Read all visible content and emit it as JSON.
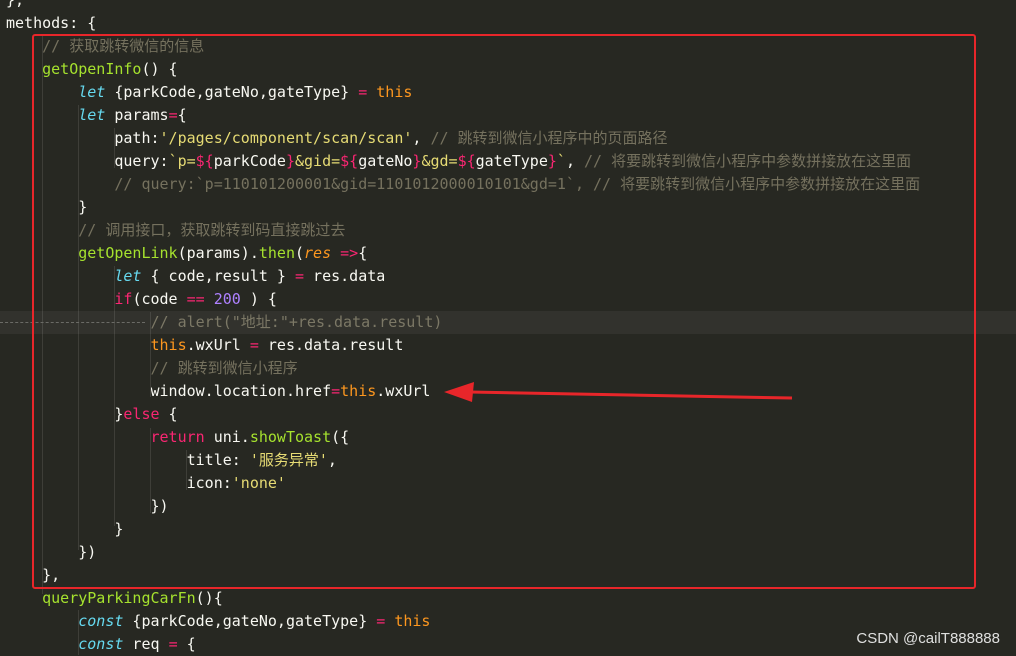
{
  "editor": {
    "lines": [
      {
        "t": [
          [
            "plain",
            "},"
          ]
        ]
      },
      {
        "t": [
          [
            "plain",
            "methods: {"
          ]
        ]
      },
      {
        "t": [
          [
            "plain",
            "    "
          ],
          [
            "c",
            "// 获取跳转微信的信息"
          ]
        ]
      },
      {
        "t": [
          [
            "plain",
            "    "
          ],
          [
            "fn",
            "getOpenInfo"
          ],
          [
            "plain",
            "() {"
          ]
        ]
      },
      {
        "t": [
          [
            "plain",
            "        "
          ],
          [
            "kw",
            "let"
          ],
          [
            "plain",
            " {parkCode,gateNo,gateType} "
          ],
          [
            "op",
            "="
          ],
          [
            "plain",
            " "
          ],
          [
            "this",
            "this"
          ]
        ]
      },
      {
        "t": [
          [
            "plain",
            "        "
          ],
          [
            "kw",
            "let"
          ],
          [
            "plain",
            " params"
          ],
          [
            "op",
            "="
          ],
          [
            "plain",
            "{"
          ]
        ]
      },
      {
        "t": [
          [
            "plain",
            "            path:"
          ],
          [
            "str",
            "'/pages/component/scan/scan'"
          ],
          [
            "plain",
            ", "
          ],
          [
            "c",
            "// 跳转到微信小程序中的页面路径"
          ]
        ]
      },
      {
        "t": [
          [
            "plain",
            "            query:"
          ],
          [
            "str",
            "`p="
          ],
          [
            "tpl",
            "${"
          ],
          [
            "plain",
            "parkCode"
          ],
          [
            "tpl",
            "}"
          ],
          [
            "str",
            "&gid="
          ],
          [
            "tpl",
            "${"
          ],
          [
            "plain",
            "gateNo"
          ],
          [
            "tpl",
            "}"
          ],
          [
            "str",
            "&gd="
          ],
          [
            "tpl",
            "${"
          ],
          [
            "plain",
            "gateType"
          ],
          [
            "tpl",
            "}"
          ],
          [
            "str",
            "`"
          ],
          [
            "plain",
            ", "
          ],
          [
            "c",
            "// 将要跳转到微信小程序中参数拼接放在这里面"
          ]
        ]
      },
      {
        "t": [
          [
            "plain",
            "            "
          ],
          [
            "c",
            "// query:`p=110101200001&gid=1101012000010101&gd=1`, // 将要跳转到微信小程序中参数拼接放在这里面"
          ]
        ]
      },
      {
        "t": [
          [
            "plain",
            "        }"
          ]
        ]
      },
      {
        "t": [
          [
            "plain",
            "        "
          ],
          [
            "c",
            "// 调用接口，获取跳转到码直接跳过去"
          ]
        ]
      },
      {
        "t": [
          [
            "plain",
            "        "
          ],
          [
            "fn",
            "getOpenLink"
          ],
          [
            "plain",
            "(params)."
          ],
          [
            "fn",
            "then"
          ],
          [
            "plain",
            "("
          ],
          [
            "param",
            "res"
          ],
          [
            "plain",
            " "
          ],
          [
            "op",
            "=>"
          ],
          [
            "plain",
            "{"
          ]
        ]
      },
      {
        "t": [
          [
            "plain",
            "            "
          ],
          [
            "kw",
            "let"
          ],
          [
            "plain",
            " { code,result } "
          ],
          [
            "op",
            "="
          ],
          [
            "plain",
            " res.data"
          ]
        ]
      },
      {
        "t": [
          [
            "plain",
            "            "
          ],
          [
            "ctl",
            "if"
          ],
          [
            "plain",
            "(code "
          ],
          [
            "op",
            "=="
          ],
          [
            "plain",
            " "
          ],
          [
            "num",
            "200"
          ],
          [
            "plain",
            " ) {"
          ]
        ]
      },
      {
        "t": [
          [
            "plain",
            "                "
          ],
          [
            "c",
            "// alert(\"地址:\"+res.data.result)"
          ]
        ]
      },
      {
        "t": [
          [
            "plain",
            "                "
          ],
          [
            "this",
            "this"
          ],
          [
            "plain",
            ".wxUrl "
          ],
          [
            "op",
            "="
          ],
          [
            "plain",
            " res.data.result"
          ]
        ]
      },
      {
        "t": [
          [
            "plain",
            "                "
          ],
          [
            "c",
            "// 跳转到微信小程序"
          ]
        ]
      },
      {
        "t": [
          [
            "plain",
            "                window.location.href"
          ],
          [
            "op",
            "="
          ],
          [
            "this",
            "this"
          ],
          [
            "plain",
            ".wxUrl"
          ]
        ]
      },
      {
        "t": [
          [
            "plain",
            "            }"
          ],
          [
            "ctl",
            "else"
          ],
          [
            "plain",
            " {"
          ]
        ]
      },
      {
        "t": [
          [
            "plain",
            "                "
          ],
          [
            "ctl",
            "return"
          ],
          [
            "plain",
            " uni."
          ],
          [
            "fn",
            "showToast"
          ],
          [
            "plain",
            "({"
          ]
        ]
      },
      {
        "t": [
          [
            "plain",
            "                    title: "
          ],
          [
            "str",
            "'服务异常'"
          ],
          [
            "plain",
            ","
          ]
        ]
      },
      {
        "t": [
          [
            "plain",
            "                    icon:"
          ],
          [
            "str",
            "'none'"
          ]
        ]
      },
      {
        "t": [
          [
            "plain",
            "                })"
          ]
        ]
      },
      {
        "t": [
          [
            "plain",
            "            }"
          ]
        ]
      },
      {
        "t": [
          [
            "plain",
            "        })"
          ]
        ]
      },
      {
        "t": [
          [
            "plain",
            "    },"
          ]
        ]
      },
      {
        "t": [
          [
            "plain",
            "    "
          ],
          [
            "fn",
            "queryParkingCarFn"
          ],
          [
            "plain",
            "(){"
          ]
        ]
      },
      {
        "t": [
          [
            "plain",
            "        "
          ],
          [
            "kw",
            "const"
          ],
          [
            "plain",
            " {parkCode,gateNo,gateType} "
          ],
          [
            "op",
            "="
          ],
          [
            "plain",
            " "
          ],
          [
            "this",
            "this"
          ]
        ]
      },
      {
        "t": [
          [
            "plain",
            "        "
          ],
          [
            "kw",
            "const"
          ],
          [
            "plain",
            " req "
          ],
          [
            "op",
            "="
          ],
          [
            "plain",
            " {"
          ]
        ]
      }
    ]
  },
  "watermark": "CSDN @cailT888888",
  "colors": {
    "background": "#272822",
    "highlight": "#e8262a"
  }
}
